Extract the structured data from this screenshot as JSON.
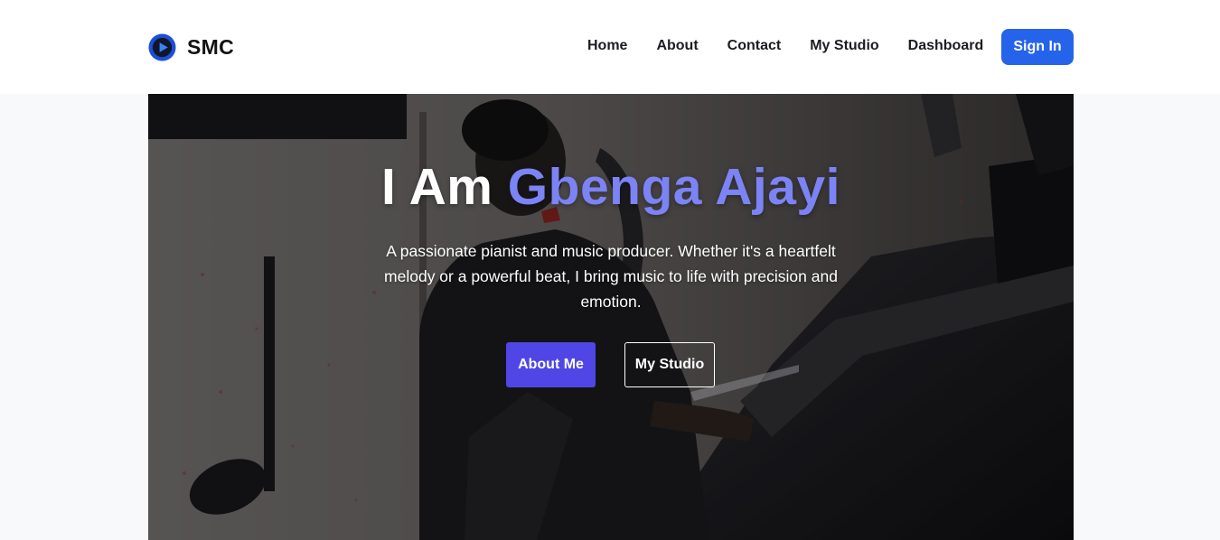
{
  "brand": {
    "name": "SMC",
    "icon": "play-circle-icon"
  },
  "nav": {
    "items": [
      {
        "label": "Home"
      },
      {
        "label": "About"
      },
      {
        "label": "Contact"
      },
      {
        "label": "My Studio"
      },
      {
        "label": "Dashboard"
      }
    ],
    "signin_label": "Sign In"
  },
  "hero": {
    "title_prefix": "I Am ",
    "title_name": "Gbenga Ajayi",
    "description": "A passionate pianist and music producer. Whether it's a heartfelt melody or a powerful beat, I bring music to life with precision and emotion.",
    "primary_button": "About Me",
    "secondary_button": "My Studio"
  },
  "colors": {
    "signin": "#2563eb",
    "name_accent": "#7c83f5",
    "primary_button": "#4f46e5"
  }
}
